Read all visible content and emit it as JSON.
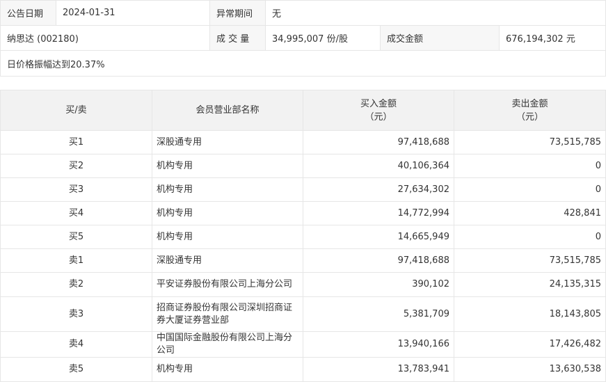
{
  "info": {
    "date_label": "公告日期",
    "date_value": "2024-01-31",
    "period_label": "异常期间",
    "period_value": "无",
    "stock": "纳思达 (002180)",
    "volume_label": "成 交 量",
    "volume_value": "34,995,007 份/股",
    "amount_label": "成交金额",
    "amount_value": "676,194,302 元",
    "reason": "日价格振幅达到20.37%"
  },
  "table": {
    "headers": [
      "买/卖",
      "会员营业部名称",
      "买入金额",
      "（元）",
      "卖出金额",
      "（元）"
    ],
    "rows": [
      {
        "side": "买1",
        "name": "深股通专用",
        "buy": "97,418,688",
        "sell": "73,515,785"
      },
      {
        "side": "买2",
        "name": "机构专用",
        "buy": "40,106,364",
        "sell": "0"
      },
      {
        "side": "买3",
        "name": "机构专用",
        "buy": "27,634,302",
        "sell": "0"
      },
      {
        "side": "买4",
        "name": "机构专用",
        "buy": "14,772,994",
        "sell": "428,841"
      },
      {
        "side": "买5",
        "name": "机构专用",
        "buy": "14,665,949",
        "sell": "0"
      },
      {
        "side": "卖1",
        "name": "深股通专用",
        "buy": "97,418,688",
        "sell": "73,515,785"
      },
      {
        "side": "卖2",
        "name": "平安证券股份有限公司上海分公司",
        "buy": "390,102",
        "sell": "24,135,315"
      },
      {
        "side": "卖3",
        "name": "招商证券股份有限公司深圳招商证券大厦证券营业部",
        "buy": "5,381,709",
        "sell": "18,143,805"
      },
      {
        "side": "卖4",
        "name": "中国国际金融股份有限公司上海分公司",
        "buy": "13,940,166",
        "sell": "17,426,482"
      },
      {
        "side": "卖5",
        "name": "机构专用",
        "buy": "13,783,941",
        "sell": "13,630,538"
      }
    ]
  }
}
